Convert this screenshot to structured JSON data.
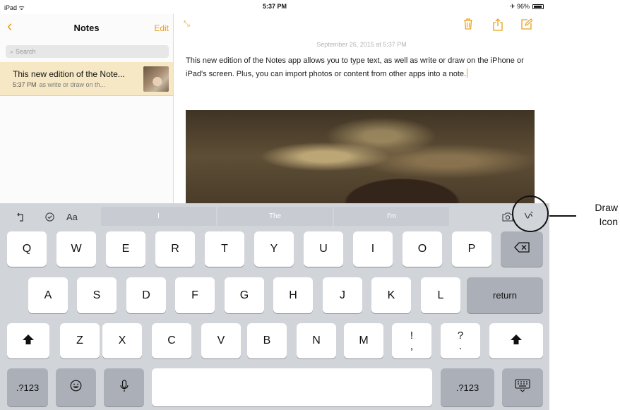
{
  "status_bar": {
    "device": "iPad ᯤ",
    "time": "5:37 PM",
    "battery": "✈ 96%"
  },
  "sidebar": {
    "back": "‹",
    "title": "Notes",
    "edit": "Edit",
    "search_placeholder": "Search",
    "note": {
      "title": "This new edition of the Note...",
      "time": "5:37 PM",
      "preview": "as write or draw on th..."
    }
  },
  "note": {
    "date": "September 26, 2015 at 5:37 PM",
    "body": "This new edition of the Notes app allows you to type text, as well as write or draw on the iPhone or iPad's screen. Plus, you can import photos or content from other apps into a note."
  },
  "icons": {
    "back": "chevron-left-icon",
    "expand": "expand-icon",
    "trash": "trash-icon",
    "share": "share-icon",
    "compose": "compose-icon",
    "undo": "undo-icon",
    "checklist": "checklist-icon",
    "camera": "camera-icon",
    "draw": "draw-icon",
    "delete": "backspace-icon",
    "shift": "shift-icon",
    "emoji": "emoji-icon",
    "mic": "microphone-icon",
    "hide_keyboard": "hide-keyboard-icon"
  },
  "keyboard": {
    "format": "Aa",
    "suggestions": [
      "I",
      "The",
      "I'm"
    ],
    "row1": [
      "Q",
      "W",
      "E",
      "R",
      "T",
      "Y",
      "U",
      "I",
      "O",
      "P"
    ],
    "row2": [
      "A",
      "S",
      "D",
      "F",
      "G",
      "H",
      "J",
      "K",
      "L"
    ],
    "row3": [
      "Z",
      "X",
      "C",
      "V",
      "B",
      "N",
      "M"
    ],
    "punct1": [
      "!",
      ","
    ],
    "punct2": [
      "?",
      "."
    ],
    "return": "return",
    "numbers": ".?123"
  },
  "annotation": {
    "label_line1": "Draw",
    "label_line2": "Icon"
  },
  "colors": {
    "accent": "#e9a019",
    "selected_note": "#f6e8c4",
    "keyboard_bg": "#d1d4d9",
    "dark_key": "#abb0b8"
  }
}
